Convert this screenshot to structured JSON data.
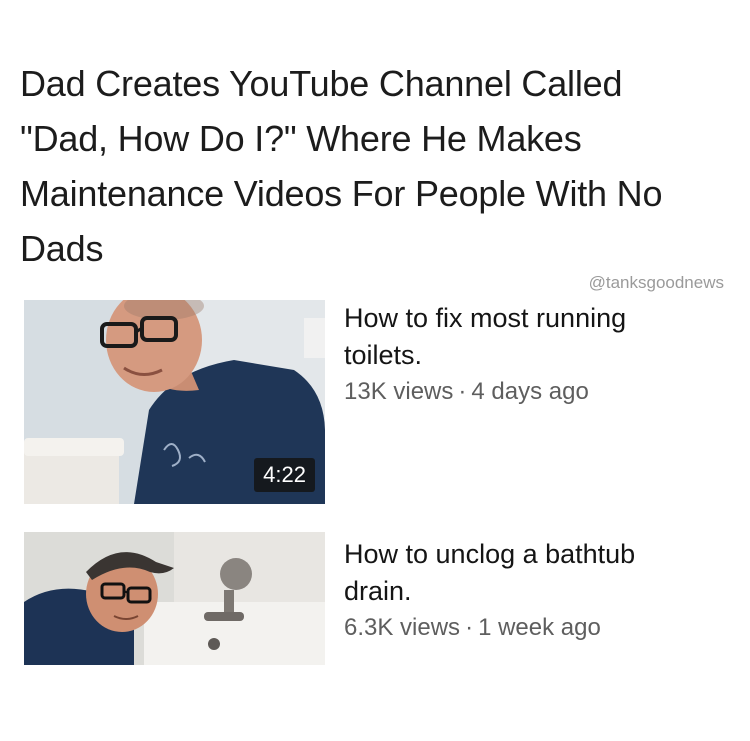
{
  "headline": {
    "lines": [
      "Dad Creates YouTube Channel Called",
      "\"Dad, How Do I?\" Where He Makes",
      "Maintenance Videos For People With No",
      "Dads"
    ]
  },
  "credit": "@tanksgoodnews",
  "videos": [
    {
      "title_lines": [
        "How to fix most running",
        "toilets."
      ],
      "views": "13K views",
      "separator": "·",
      "age": "4 days ago",
      "duration": "4:22",
      "thumbnail_icon": "man-leaning-over-toilet-thumbnail"
    },
    {
      "title_lines": [
        "How to unclog a bathtub",
        "drain."
      ],
      "views": "6.3K views",
      "separator": "·",
      "age": "1 week ago",
      "thumbnail_icon": "man-by-bathtub-faucet-thumbnail"
    }
  ]
}
